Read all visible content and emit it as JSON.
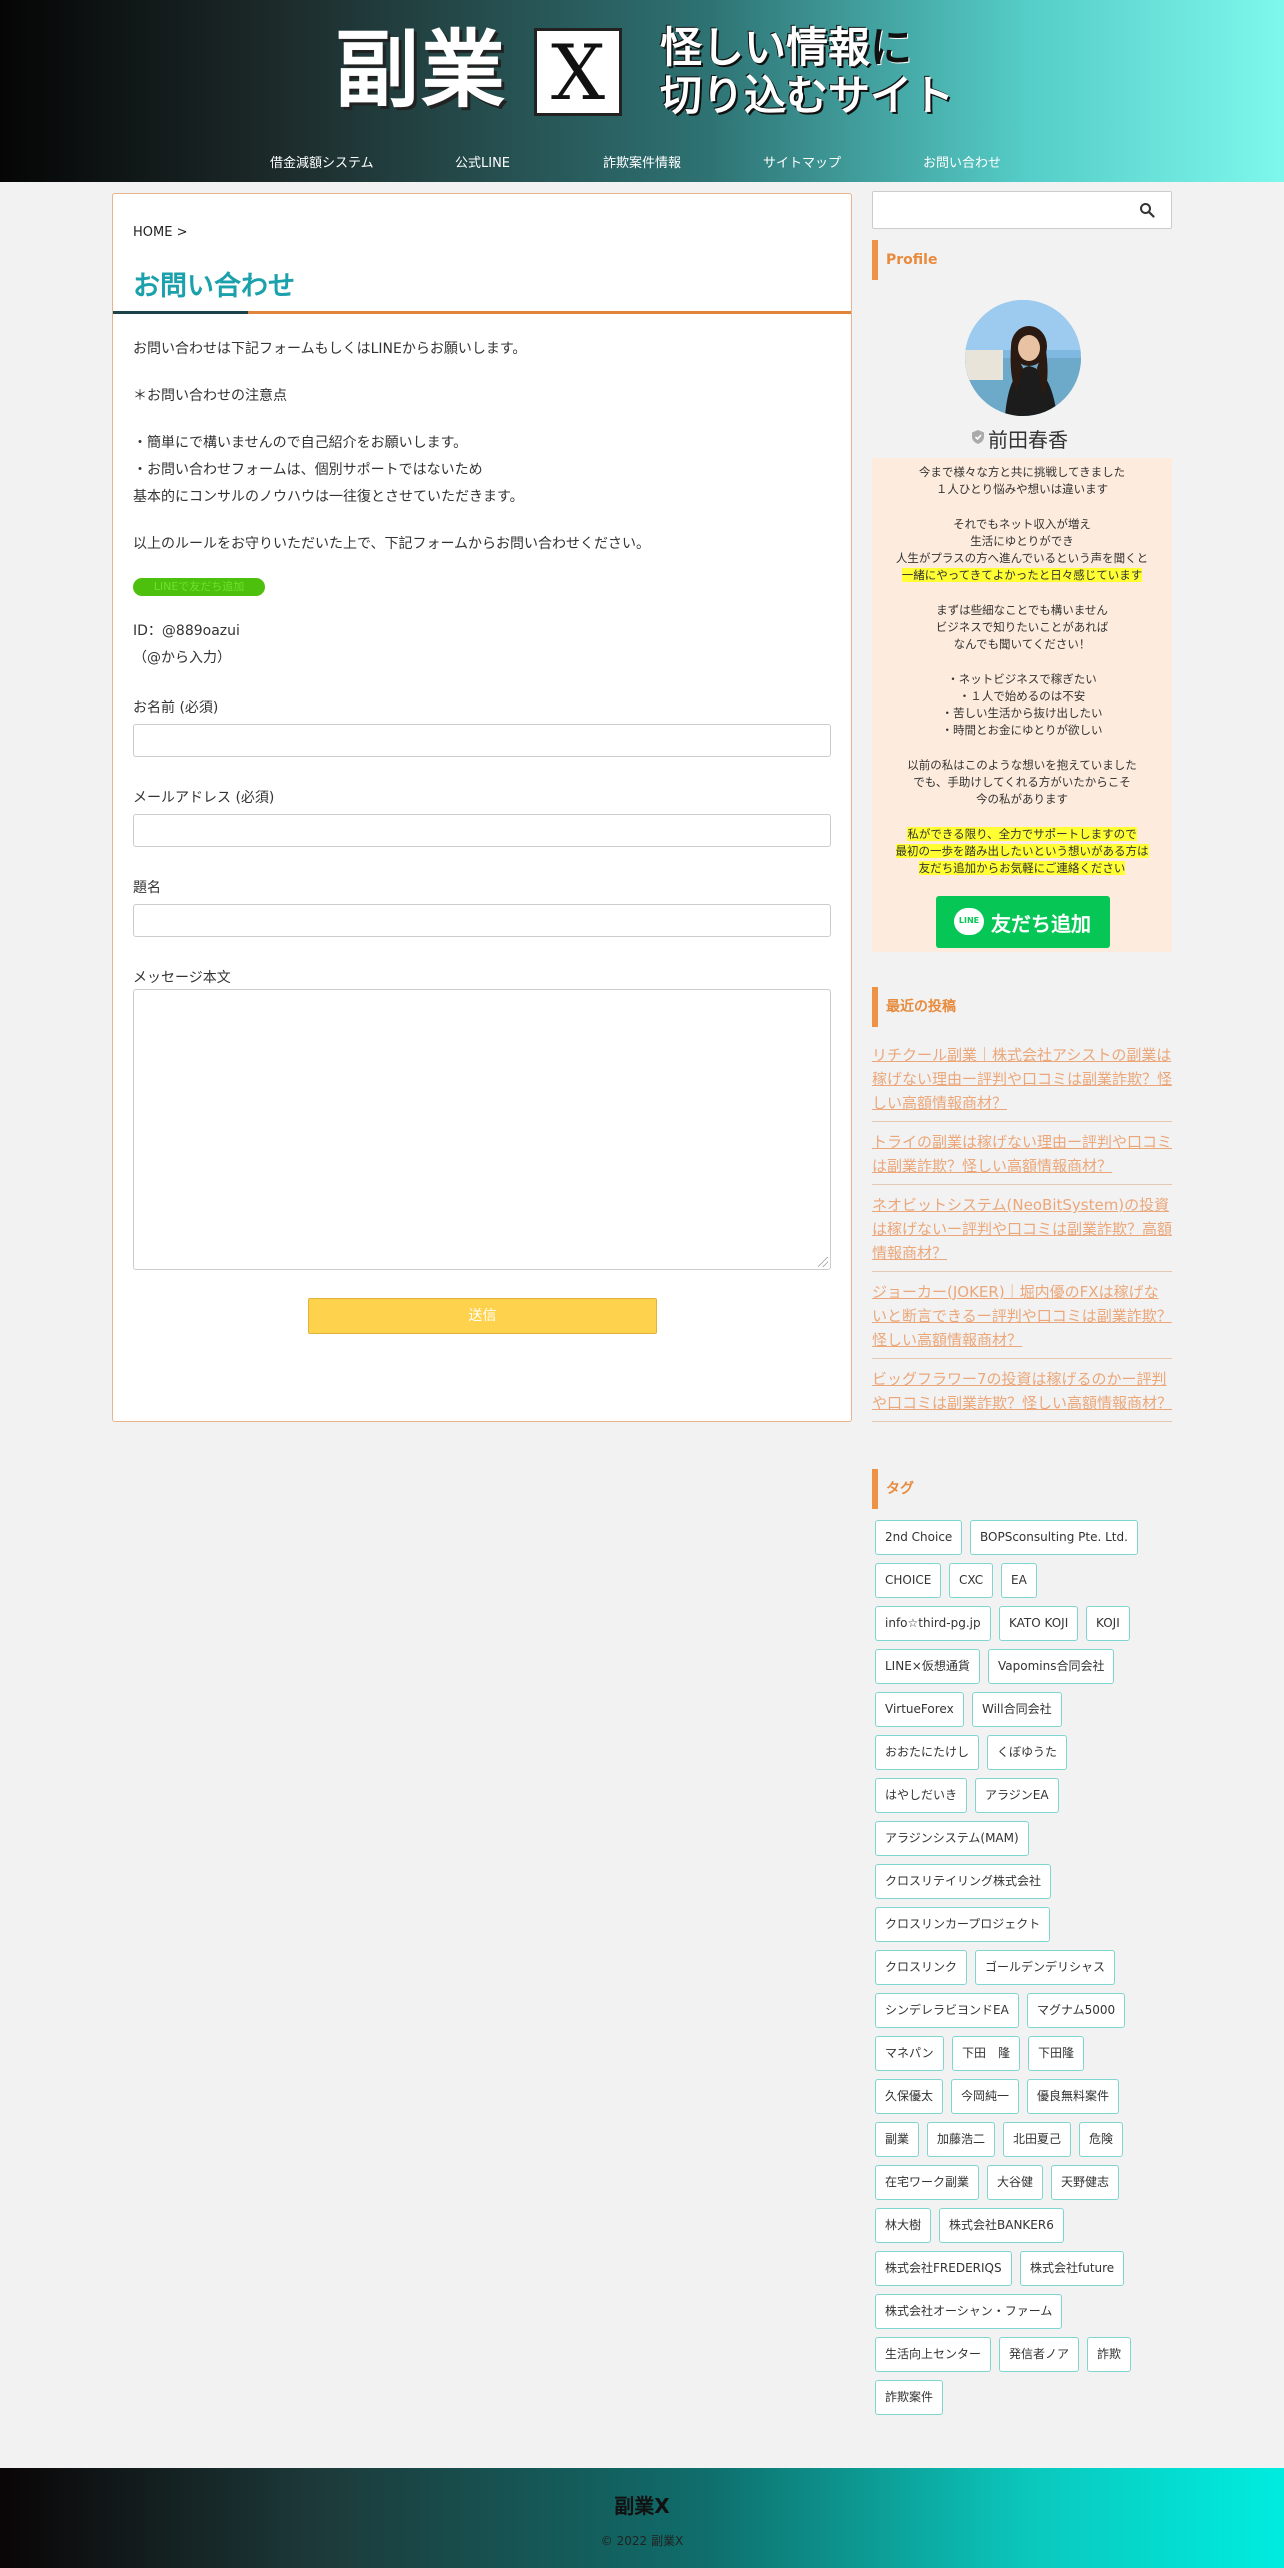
{
  "header": {
    "logo_main": "副業",
    "logo_x": "X",
    "logo_tag_line1_a": "怪しい情報",
    "logo_tag_line1_b": "に",
    "logo_tag_line2": "切り込むサイト",
    "nav": [
      "借金減額システム",
      "公式LINE",
      "詐欺案件情報",
      "サイトマップ",
      "お問い合わせ"
    ]
  },
  "breadcrumb": "HOME >",
  "page_title": "お問い合わせ",
  "body": {
    "intro": "お問い合わせは下記フォームもしくはLINEからお願いします。",
    "notes_heading": "＊お問い合わせの注意点",
    "note1": "・簡単にで構いませんので自己紹介をお願いします。",
    "note2": "・お問い合わせフォームは、個別サポートではないため",
    "note3": "基本的にコンサルのノウハウは一往復とさせていただきます。",
    "outro": "以上のルールをお守りいただいた上で、下記フォームからお問い合わせください。",
    "line_button": "LINEで友だち追加",
    "line_id": "ID：@889oazui",
    "line_id_note": "（@から入力）"
  },
  "form": {
    "name_label": "お名前 (必須)",
    "email_label": "メールアドレス (必須)",
    "subject_label": "題名",
    "message_label": "メッセージ本文",
    "submit": "送信"
  },
  "sidebar": {
    "profile_title": "Profile",
    "profile_name": "前田春香",
    "profile_lines": [
      "今まで様々な方と共に挑戦してきました",
      "１人ひとり悩みや想いは違います",
      "",
      "それでもネット収入が増え",
      "生活にゆとりができ",
      "人生がプラスの方へ進んでいるという声を聞くと",
      "一緒にやってきてよかったと日々感じています",
      "",
      "まずは些細なことでも構いません",
      "ビジネスで知りたいことがあれば",
      "なんでも聞いてください！",
      "",
      "・ネットビジネスで稼ぎたい",
      "・１人で始めるのは不安",
      "・苦しい生活から抜け出したい",
      "・時間とお金にゆとりが欲しい",
      "",
      "以前の私はこのような想いを抱えていました",
      "でも、手助けしてくれる方がいたからこそ",
      "今の私があります",
      "",
      "私ができる限り、全力でサポートしますので",
      "最初の一歩を踏み出したいという想いがある方は",
      "友だち追加からお気軽にご連絡ください"
    ],
    "add_friend_label": "友だち追加",
    "add_friend_icon_text": "LINE",
    "recent_title": "最近の投稿",
    "recent_posts": [
      "リチクール副業｜株式会社アシストの副業は稼げない理由ー評判や口コミは副業詐欺？怪しい高額情報商材？",
      "トライの副業は稼げない理由ー評判や口コミは副業詐欺？怪しい高額情報商材？",
      "ネオビットシステム(NeoBitSystem)の投資は稼げないー評判や口コミは副業詐欺？高額情報商材？",
      "ジョーカー(JOKER)｜堀内優のFXは稼げないと断言できるー評判や口コミは副業詐欺？怪しい高額情報商材？",
      "ビッグフラワー7の投資は稼げるのかー評判や口コミは副業詐欺？怪しい高額情報商材？"
    ],
    "tags_title": "タグ",
    "tags": [
      [
        "2nd Choice",
        "BOPSconsulting Pte. Ltd."
      ],
      [
        "CHOICE",
        "CXC",
        "EA"
      ],
      [
        "info☆third-pg.jp",
        "KATO KOJI",
        "KOJI"
      ],
      [
        "LINE×仮想通貨",
        "Vapomins合同会社"
      ],
      [
        "VirtueForex",
        "Will合同会社"
      ],
      [
        "おおたにたけし",
        "くぼゆうた"
      ],
      [
        "はやしだいき",
        "アラジンEA"
      ],
      [
        "アラジンシステム(MAM)"
      ],
      [
        "クロスリテイリング株式会社"
      ],
      [
        "クロスリンカープロジェクト"
      ],
      [
        "クロスリンク",
        "ゴールデンデリシャス"
      ],
      [
        "シンデレラビヨンドEA",
        "マグナム5000"
      ],
      [
        "マネパン",
        "下田　隆",
        "下田隆"
      ],
      [
        "久保優太",
        "今岡純一",
        "優良無料案件"
      ],
      [
        "副業",
        "加藤浩二",
        "北田夏己",
        "危険"
      ],
      [
        "在宅ワーク副業",
        "大谷健",
        "天野健志"
      ],
      [
        "林大樹",
        "株式会社BANKER6"
      ],
      [
        "株式会社FREDERIQS",
        "株式会社future"
      ],
      [
        "株式会社オーシャン・ファーム"
      ],
      [
        "生活向上センター",
        "発信者ノア",
        "詐欺"
      ],
      [
        "詐欺案件"
      ]
    ]
  },
  "footer": {
    "title": "副業X",
    "copyright": "© 2022 副業X"
  }
}
